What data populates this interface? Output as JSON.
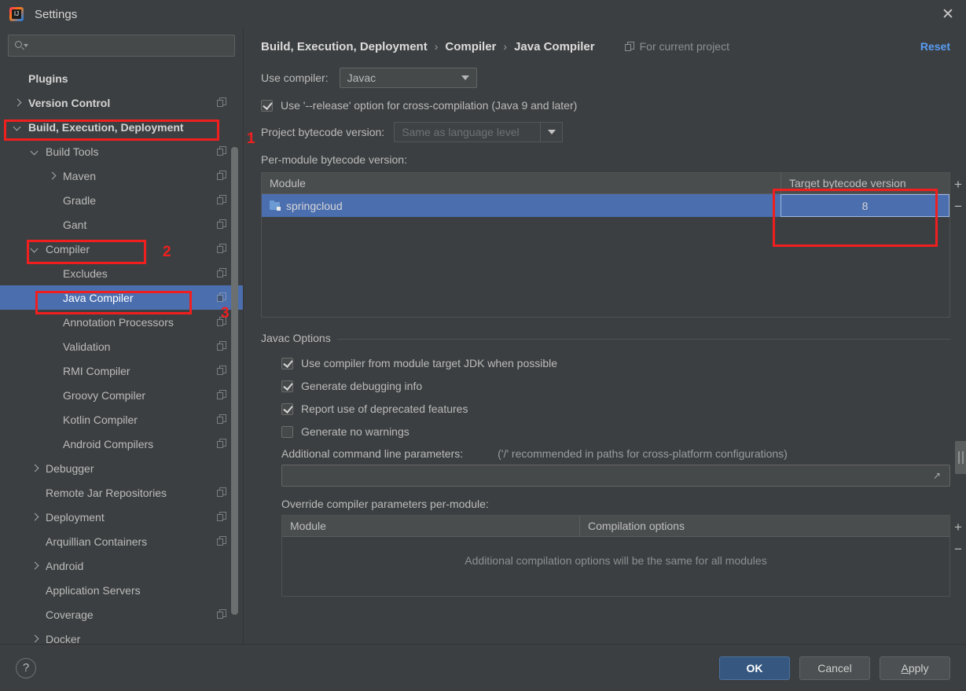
{
  "window": {
    "title": "Settings",
    "logo_icon": "intellij-idea-logo",
    "logo_text": "IJ",
    "close_icon": "close-icon"
  },
  "search": {
    "value": "",
    "placeholder": "",
    "icon": "search-icon"
  },
  "sidebar": {
    "items": [
      {
        "label": "Plugins",
        "indent": 0,
        "arrow": "none",
        "bold": true,
        "copy": false,
        "selected": false
      },
      {
        "label": "Version Control",
        "indent": 0,
        "arrow": "right",
        "bold": true,
        "copy": true,
        "selected": false
      },
      {
        "label": "Build, Execution, Deployment",
        "indent": 0,
        "arrow": "down",
        "bold": true,
        "copy": false,
        "selected": false
      },
      {
        "label": "Build Tools",
        "indent": 1,
        "arrow": "down",
        "bold": false,
        "copy": true,
        "selected": false
      },
      {
        "label": "Maven",
        "indent": 2,
        "arrow": "right",
        "bold": false,
        "copy": true,
        "selected": false
      },
      {
        "label": "Gradle",
        "indent": 2,
        "arrow": "none",
        "bold": false,
        "copy": true,
        "selected": false
      },
      {
        "label": "Gant",
        "indent": 2,
        "arrow": "none",
        "bold": false,
        "copy": true,
        "selected": false
      },
      {
        "label": "Compiler",
        "indent": 1,
        "arrow": "down",
        "bold": false,
        "copy": true,
        "selected": false
      },
      {
        "label": "Excludes",
        "indent": 2,
        "arrow": "none",
        "bold": false,
        "copy": true,
        "selected": false
      },
      {
        "label": "Java Compiler",
        "indent": 2,
        "arrow": "none",
        "bold": false,
        "copy": true,
        "selected": true
      },
      {
        "label": "Annotation Processors",
        "indent": 2,
        "arrow": "none",
        "bold": false,
        "copy": true,
        "selected": false
      },
      {
        "label": "Validation",
        "indent": 2,
        "arrow": "none",
        "bold": false,
        "copy": true,
        "selected": false
      },
      {
        "label": "RMI Compiler",
        "indent": 2,
        "arrow": "none",
        "bold": false,
        "copy": true,
        "selected": false
      },
      {
        "label": "Groovy Compiler",
        "indent": 2,
        "arrow": "none",
        "bold": false,
        "copy": true,
        "selected": false
      },
      {
        "label": "Kotlin Compiler",
        "indent": 2,
        "arrow": "none",
        "bold": false,
        "copy": true,
        "selected": false
      },
      {
        "label": "Android Compilers",
        "indent": 2,
        "arrow": "none",
        "bold": false,
        "copy": true,
        "selected": false
      },
      {
        "label": "Debugger",
        "indent": 1,
        "arrow": "right",
        "bold": false,
        "copy": false,
        "selected": false
      },
      {
        "label": "Remote Jar Repositories",
        "indent": 1,
        "arrow": "none",
        "bold": false,
        "copy": true,
        "selected": false
      },
      {
        "label": "Deployment",
        "indent": 1,
        "arrow": "right",
        "bold": false,
        "copy": true,
        "selected": false
      },
      {
        "label": "Arquillian Containers",
        "indent": 1,
        "arrow": "none",
        "bold": false,
        "copy": true,
        "selected": false
      },
      {
        "label": "Android",
        "indent": 1,
        "arrow": "right",
        "bold": false,
        "copy": false,
        "selected": false
      },
      {
        "label": "Application Servers",
        "indent": 1,
        "arrow": "none",
        "bold": false,
        "copy": false,
        "selected": false
      },
      {
        "label": "Coverage",
        "indent": 1,
        "arrow": "none",
        "bold": false,
        "copy": true,
        "selected": false
      },
      {
        "label": "Docker",
        "indent": 1,
        "arrow": "right",
        "bold": false,
        "copy": false,
        "selected": false
      }
    ]
  },
  "header": {
    "crumb1": "Build, Execution, Deployment",
    "crumb2": "Compiler",
    "crumb3": "Java Compiler",
    "separator": "›",
    "scope_label": "For current project",
    "scope_icon": "copy-settings-icon",
    "reset_label": "Reset"
  },
  "main": {
    "use_compiler_label": "Use compiler:",
    "use_compiler_value": "Javac",
    "release_option_label": "Use '--release' option for cross-compilation (Java 9 and later)",
    "release_option_checked": true,
    "project_bytecode_label": "Project bytecode version:",
    "project_bytecode_value": "Same as language level",
    "project_bytecode_disabled": true,
    "per_module_label": "Per-module bytecode version:",
    "module_table": {
      "columns": [
        "Module",
        "Target bytecode version"
      ],
      "rows": [
        {
          "module": "springcloud",
          "target": "8",
          "selected": true,
          "editing": true
        }
      ],
      "add_label": "+",
      "remove_label": "−"
    },
    "javac_group_title": "Javac Options",
    "javac_options": [
      {
        "label": "Use compiler from module target JDK when possible",
        "checked": true
      },
      {
        "label": "Generate debugging info",
        "checked": true
      },
      {
        "label": "Report use of deprecated features",
        "checked": true
      },
      {
        "label": "Generate no warnings",
        "checked": false
      }
    ],
    "additional_params_label": "Additional command line parameters:",
    "additional_params_hint": "('/' recommended in paths for cross-platform configurations)",
    "additional_params_value": "",
    "expand_icon": "expand-icon",
    "override_label": "Override compiler parameters per-module:",
    "override_table": {
      "columns": [
        "Module",
        "Compilation options"
      ],
      "empty_message": "Additional compilation options will be the same for all modules",
      "add_label": "+",
      "remove_label": "−"
    }
  },
  "footer": {
    "help_label": "?",
    "ok_label": "OK",
    "cancel_label": "Cancel",
    "apply_label": "Apply",
    "apply_mnemonic": "A",
    "apply_rest": "pply"
  },
  "annotations": {
    "num1": "1",
    "num2": "2",
    "num3": "3",
    "color": "#f01f1f"
  },
  "colors": {
    "window_bg": "#3c3f41",
    "selection_blue": "#4b6eaf",
    "link_blue": "#589df6",
    "primary_button": "#365880",
    "annotation_red": "#f01f1f"
  }
}
